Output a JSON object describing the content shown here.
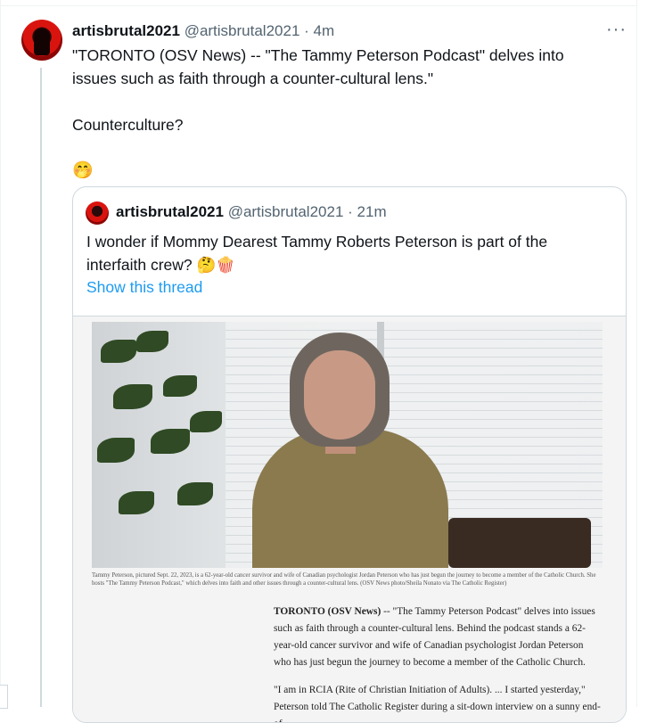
{
  "tweet": {
    "author_name": "artisbrutal2021",
    "author_handle": "@artisbrutal2021",
    "separator": "·",
    "timestamp": "4m",
    "text_line1": "\"TORONTO (OSV News) -- \"The Tammy Peterson Podcast\" delves into issues such as faith through a counter-cultural lens.\"",
    "text_line2": "Counterculture?",
    "emoji": "🤭",
    "more_label": "···"
  },
  "quote": {
    "author_name": "artisbrutal2021",
    "author_handle": "@artisbrutal2021",
    "separator": "·",
    "timestamp": "21m",
    "text": "I wonder if Mommy Dearest Tammy Roberts Peterson is part of the interfaith crew? 🤔🍿",
    "show_thread": "Show this thread"
  },
  "media": {
    "caption": "Tammy Peterson, pictured Sept. 22, 2023, is a 62-year-old cancer survivor and wife of Canadian psychologist Jordan Peterson who has just begun the journey to become a member of the Catholic Church. She hosts \"The Tammy Peterson Podcast,\" which delves into faith and other issues through a counter-cultural lens. (OSV News photo/Sheila Nonato via The Catholic Register)",
    "dateline": "TORONTO (OSV News)",
    "paragraph1": " -- \"The Tammy Peterson Podcast\" delves into issues such as faith through a counter-cultural lens. Behind the podcast stands a 62-year-old cancer survivor and wife of Canadian psychologist Jordan Peterson who has just begun the journey to become a member of the Catholic Church.",
    "paragraph2": "\"I am in RCIA (Rite of Christian Initiation of Adults). ... I started yesterday,\" Peterson told The Catholic Register during a sit-down interview on a sunny end-of-"
  },
  "colors": {
    "link": "#1d9bf0",
    "secondary_text": "#536471",
    "border": "#cfd9de"
  }
}
